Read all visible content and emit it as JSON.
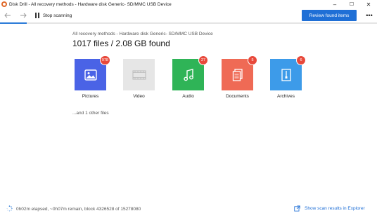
{
  "window": {
    "title": "Disk Drill - All recovery methods - Hardware disk Generic- SD/MMC USB Device",
    "minimize": "–",
    "maximize": "☐",
    "close": "✕"
  },
  "toolbar": {
    "back_icon": "arrow-left-icon",
    "forward_icon": "arrow-right-icon",
    "stop_label": "Stop scanning",
    "review_label": "Review found items",
    "more_label": "•••",
    "scan_progress": 0.07,
    "accent": "#1f6fd6"
  },
  "summary": {
    "subtitle": "All recovery methods - Hardware disk Generic- SD/MMC USB Device",
    "headline": "1017 files / 2.08 GB found"
  },
  "categories": [
    {
      "label": "Pictures",
      "count": "978",
      "icon": "image-icon",
      "color": "#4a63e6"
    },
    {
      "label": "Video",
      "count": "",
      "icon": "film-icon",
      "color": "#e6e6e6"
    },
    {
      "label": "Audio",
      "count": "27",
      "icon": "music-note-icon",
      "color": "#2fb457"
    },
    {
      "label": "Documents",
      "count": "5",
      "icon": "documents-icon",
      "color": "#ef6a55"
    },
    {
      "label": "Archives",
      "count": "6",
      "icon": "archive-icon",
      "color": "#3d9be9"
    }
  ],
  "other_files": "...and 1 other files",
  "status": {
    "text": "0h02m elapsed, ~0h07m remain, block 4326528 of 15278080",
    "explorer_label": "Show scan results in Explorer"
  }
}
